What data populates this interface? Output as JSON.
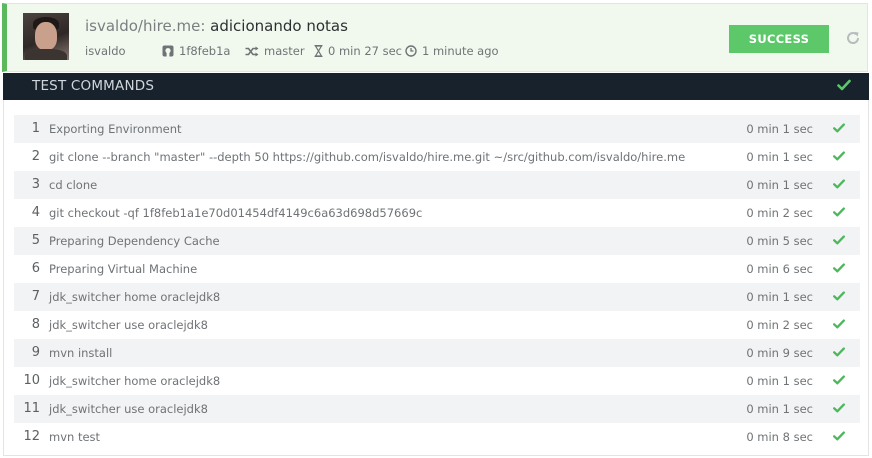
{
  "header": {
    "repo": "isvaldo/hire.me",
    "separator": ":",
    "commit_message": "adicionando notas",
    "author": "isvaldo",
    "commit_hash": "1f8feb1a",
    "branch": "master",
    "duration": "0 min 27 sec",
    "finished": "1 minute ago",
    "status_label": "SUCCESS"
  },
  "section": {
    "title": "TEST COMMANDS"
  },
  "colors": {
    "success": "#5cc86a",
    "check": "#4cb85a",
    "dark_bar": "#17222c"
  },
  "commands": [
    {
      "num": "1",
      "text": "Exporting Environment",
      "time": "0 min 1 sec"
    },
    {
      "num": "2",
      "text": "git clone --branch \"master\" --depth 50 https://github.com/isvaldo/hire.me.git ~/src/github.com/isvaldo/hire.me",
      "time": "0 min 1 sec"
    },
    {
      "num": "3",
      "text": "cd clone",
      "time": "0 min 1 sec"
    },
    {
      "num": "4",
      "text": "git checkout -qf 1f8feb1a1e70d01454df4149c6a63d698d57669c",
      "time": "0 min 2 sec"
    },
    {
      "num": "5",
      "text": "Preparing Dependency Cache",
      "time": "0 min 5 sec"
    },
    {
      "num": "6",
      "text": "Preparing Virtual Machine",
      "time": "0 min 6 sec"
    },
    {
      "num": "7",
      "text": "jdk_switcher home oraclejdk8",
      "time": "0 min 1 sec"
    },
    {
      "num": "8",
      "text": "jdk_switcher use oraclejdk8",
      "time": "0 min 2 sec"
    },
    {
      "num": "9",
      "text": "mvn install",
      "time": "0 min 9 sec"
    },
    {
      "num": "10",
      "text": "jdk_switcher home oraclejdk8",
      "time": "0 min 1 sec"
    },
    {
      "num": "11",
      "text": "jdk_switcher use oraclejdk8",
      "time": "0 min 1 sec"
    },
    {
      "num": "12",
      "text": "mvn test",
      "time": "0 min 8 sec"
    }
  ]
}
